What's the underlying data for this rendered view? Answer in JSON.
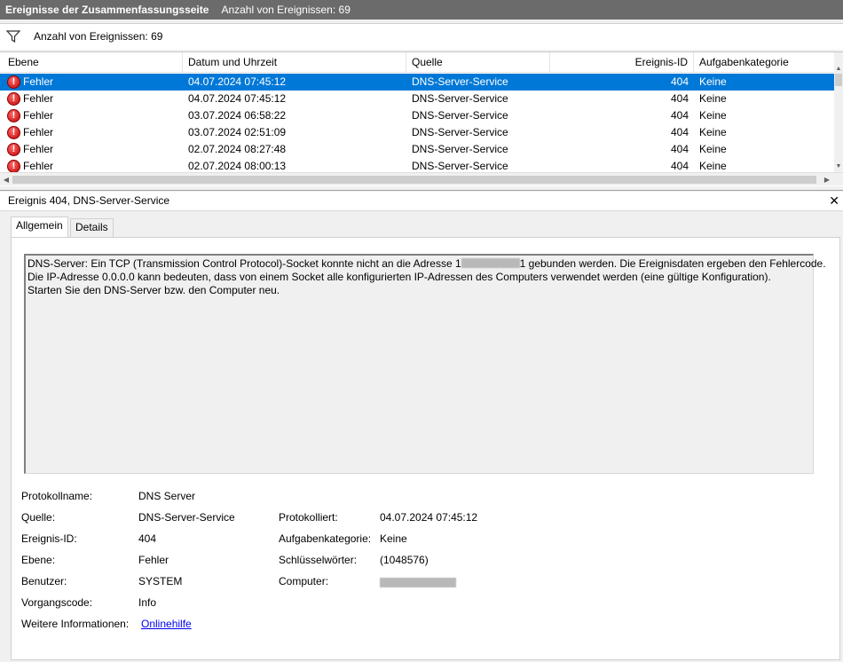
{
  "titlebar": {
    "title": "Ereignisse der Zusammenfassungsseite",
    "count_text": "Anzahl von Ereignissen: 69"
  },
  "filterbar": {
    "icon": "filter-icon",
    "count_text": "Anzahl von Ereignissen: 69"
  },
  "grid": {
    "columns": [
      "Ebene",
      "Datum und Uhrzeit",
      "Quelle",
      "Ereignis-ID",
      "Aufgabenkategorie"
    ],
    "rows": [
      {
        "level": "Fehler",
        "datetime": "04.07.2024 07:45:12",
        "source": "DNS-Server-Service",
        "id": "404",
        "category": "Keine",
        "selected": true
      },
      {
        "level": "Fehler",
        "datetime": "04.07.2024 07:45:12",
        "source": "DNS-Server-Service",
        "id": "404",
        "category": "Keine"
      },
      {
        "level": "Fehler",
        "datetime": "03.07.2024 06:58:22",
        "source": "DNS-Server-Service",
        "id": "404",
        "category": "Keine"
      },
      {
        "level": "Fehler",
        "datetime": "03.07.2024 02:51:09",
        "source": "DNS-Server-Service",
        "id": "404",
        "category": "Keine"
      },
      {
        "level": "Fehler",
        "datetime": "02.07.2024 08:27:48",
        "source": "DNS-Server-Service",
        "id": "404",
        "category": "Keine"
      },
      {
        "level": "Fehler",
        "datetime": "02.07.2024 08:00:13",
        "source": "DNS-Server-Service",
        "id": "404",
        "category": "Keine"
      }
    ]
  },
  "detail": {
    "header": "Ereignis 404, DNS-Server-Service",
    "close_symbol": "✕",
    "tabs": [
      "Allgemein",
      "Details"
    ],
    "description": {
      "line1_before": "DNS-Server: Ein TCP (Transmission Control Protocol)-Socket konnte nicht an die Adresse 1",
      "line1_after": "1 gebunden werden. Die Ereignisdaten ergeben den Fehlercode.",
      "line2": "Die IP-Adresse 0.0.0.0 kann bedeuten, dass von einem Socket alle konfigurierten IP-Adressen des Computers verwendet werden (eine gültige Konfiguration).",
      "line3": "Starten Sie den DNS-Server bzw. den Computer neu."
    },
    "properties": {
      "protokollname_label": "Protokollname:",
      "protokollname": "DNS Server",
      "quelle_label": "Quelle:",
      "quelle": "DNS-Server-Service",
      "protokolliert_label": "Protokolliert:",
      "protokolliert": "04.07.2024 07:45:12",
      "ereignis_id_label": "Ereignis-ID:",
      "ereignis_id": "404",
      "aufgabenkategorie_label": "Aufgabenkategorie:",
      "aufgabenkategorie": "Keine",
      "ebene_label": "Ebene:",
      "ebene": "Fehler",
      "schluesselwoerter_label": "Schlüsselwörter:",
      "schluesselwoerter": "(1048576)",
      "benutzer_label": "Benutzer:",
      "benutzer": "SYSTEM",
      "computer_label": "Computer:",
      "vorgangscode_label": "Vorgangscode:",
      "vorgangscode": "Info",
      "weitere_label": "Weitere Informationen:",
      "weitere_link": "Onlinehilfe"
    }
  }
}
